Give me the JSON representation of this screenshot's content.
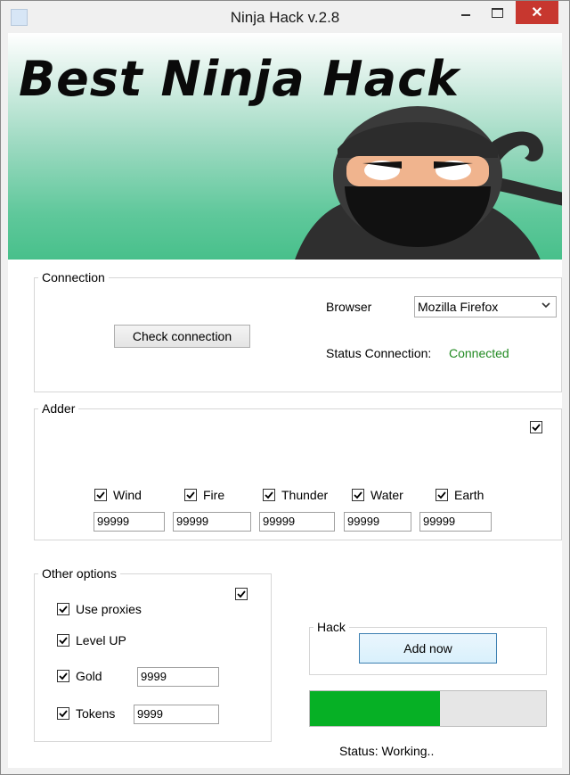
{
  "window": {
    "title": "Ninja Hack v.2.8",
    "close_glyph": "✕"
  },
  "banner": {
    "title": "Best Ninja Hack",
    "image": "ninja-mascot"
  },
  "connection": {
    "legend": "Connection",
    "check_button": "Check connection",
    "browser_label": "Browser",
    "browser_value": "Mozilla Firefox",
    "status_label": "Status Connection:",
    "status_value": "Connected",
    "status_color": "#218a21"
  },
  "adder": {
    "legend": "Adder",
    "master_checked": true,
    "elements": [
      {
        "label": "Wind",
        "checked": true,
        "value": "99999"
      },
      {
        "label": "Fire",
        "checked": true,
        "value": "99999"
      },
      {
        "label": "Thunder",
        "checked": true,
        "value": "99999"
      },
      {
        "label": "Water",
        "checked": true,
        "value": "99999"
      },
      {
        "label": "Earth",
        "checked": true,
        "value": "99999"
      }
    ]
  },
  "options": {
    "legend": "Other options",
    "master_checked": true,
    "use_proxies": "Use proxies",
    "level_up": "Level UP",
    "gold": "Gold",
    "gold_value": "9999",
    "tokens": "Tokens",
    "tokens_value": "9999"
  },
  "hack": {
    "legend": "Hack",
    "button": "Add now"
  },
  "progress": {
    "percent": 55,
    "color": "#06b025"
  },
  "status": {
    "text": "Status: Working.."
  }
}
